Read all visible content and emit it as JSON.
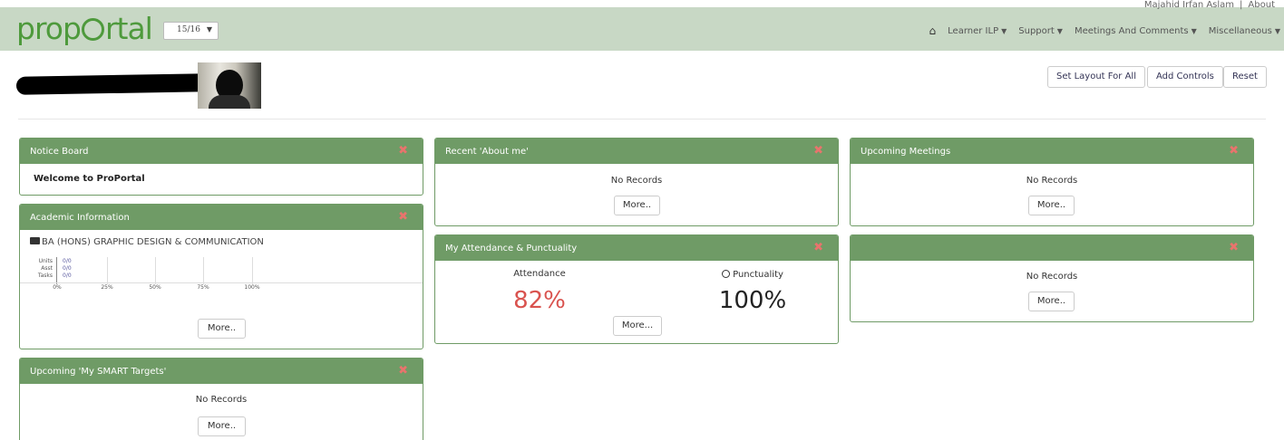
{
  "nav": {
    "logo_text_a": "prop",
    "logo_text_b": "rtal",
    "year_value": "15/16",
    "user_name": "Majahid Irfan Aslam",
    "separator": "|",
    "about": "About",
    "menu": [
      "Learner ILP",
      "Support",
      "Meetings And Comments",
      "Miscellaneous"
    ]
  },
  "header": {
    "set_layout": "Set Layout For All",
    "add_controls": "Add Controls",
    "reset": "Reset"
  },
  "panels": {
    "notice": {
      "title": "Notice Board",
      "text": "Welcome to ProPortal"
    },
    "academic": {
      "title": "Academic Information",
      "course": "BA (HONS) GRAPHIC DESIGN & COMMUNICATION",
      "rows": [
        {
          "label": "Units",
          "value": "0/0"
        },
        {
          "label": "Asst",
          "value": "0/0"
        },
        {
          "label": "Tasks",
          "value": "0/0"
        }
      ],
      "ticks": [
        "0%",
        "25%",
        "50%",
        "75%",
        "100%"
      ],
      "more": "More.."
    },
    "smart": {
      "title": "Upcoming 'My SMART Targets'",
      "no_records": "No Records",
      "more": "More.."
    },
    "about_me": {
      "title": "Recent 'About me'",
      "no_records": "No Records",
      "more": "More.."
    },
    "attendance": {
      "title": "My Attendance & Punctuality",
      "attendance_label": "Attendance",
      "attendance_value": "82%",
      "punctuality_label": "Punctuality",
      "punctuality_value": "100%",
      "more": "More..."
    },
    "meetings": {
      "title": "Upcoming Meetings",
      "no_records": "No Records",
      "more": "More.."
    },
    "untitled": {
      "title": "",
      "no_records": "No Records",
      "more": "More.."
    }
  },
  "colors": {
    "panel_header": "#6f9b66",
    "navbar": "#c8d8c5",
    "attendance": "#d9534f",
    "close": "#e8746d"
  }
}
